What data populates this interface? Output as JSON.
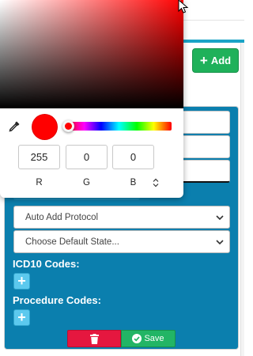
{
  "header": {
    "add_button_label": "Add"
  },
  "form": {
    "auto_add_protocol": {
      "selected": "Auto Add Protocol"
    },
    "default_state": {
      "selected": "Choose Default State..."
    },
    "icd10_label": "ICD10 Codes:",
    "procedure_label": "Procedure Codes:",
    "plus_symbol": "+",
    "save_label": "Save"
  },
  "color_picker": {
    "channels": [
      {
        "label": "R",
        "value": "255"
      },
      {
        "label": "G",
        "value": "0"
      },
      {
        "label": "B",
        "value": "0"
      }
    ],
    "hue_fraction": 0.0
  },
  "colors": {
    "selected_color": "#ff0000",
    "panel_bg": "#0b7fae",
    "add_green": "#1fb15a",
    "delete_red": "#e5173f",
    "save_green": "#22b565",
    "plus_button": "#5cc9ee"
  },
  "icons": [
    "eyedropper-icon",
    "trash-icon",
    "check-circle-icon",
    "chevron-down-icon",
    "plus-icon",
    "mouse-cursor-icon",
    "up-down-arrows-icon"
  ]
}
